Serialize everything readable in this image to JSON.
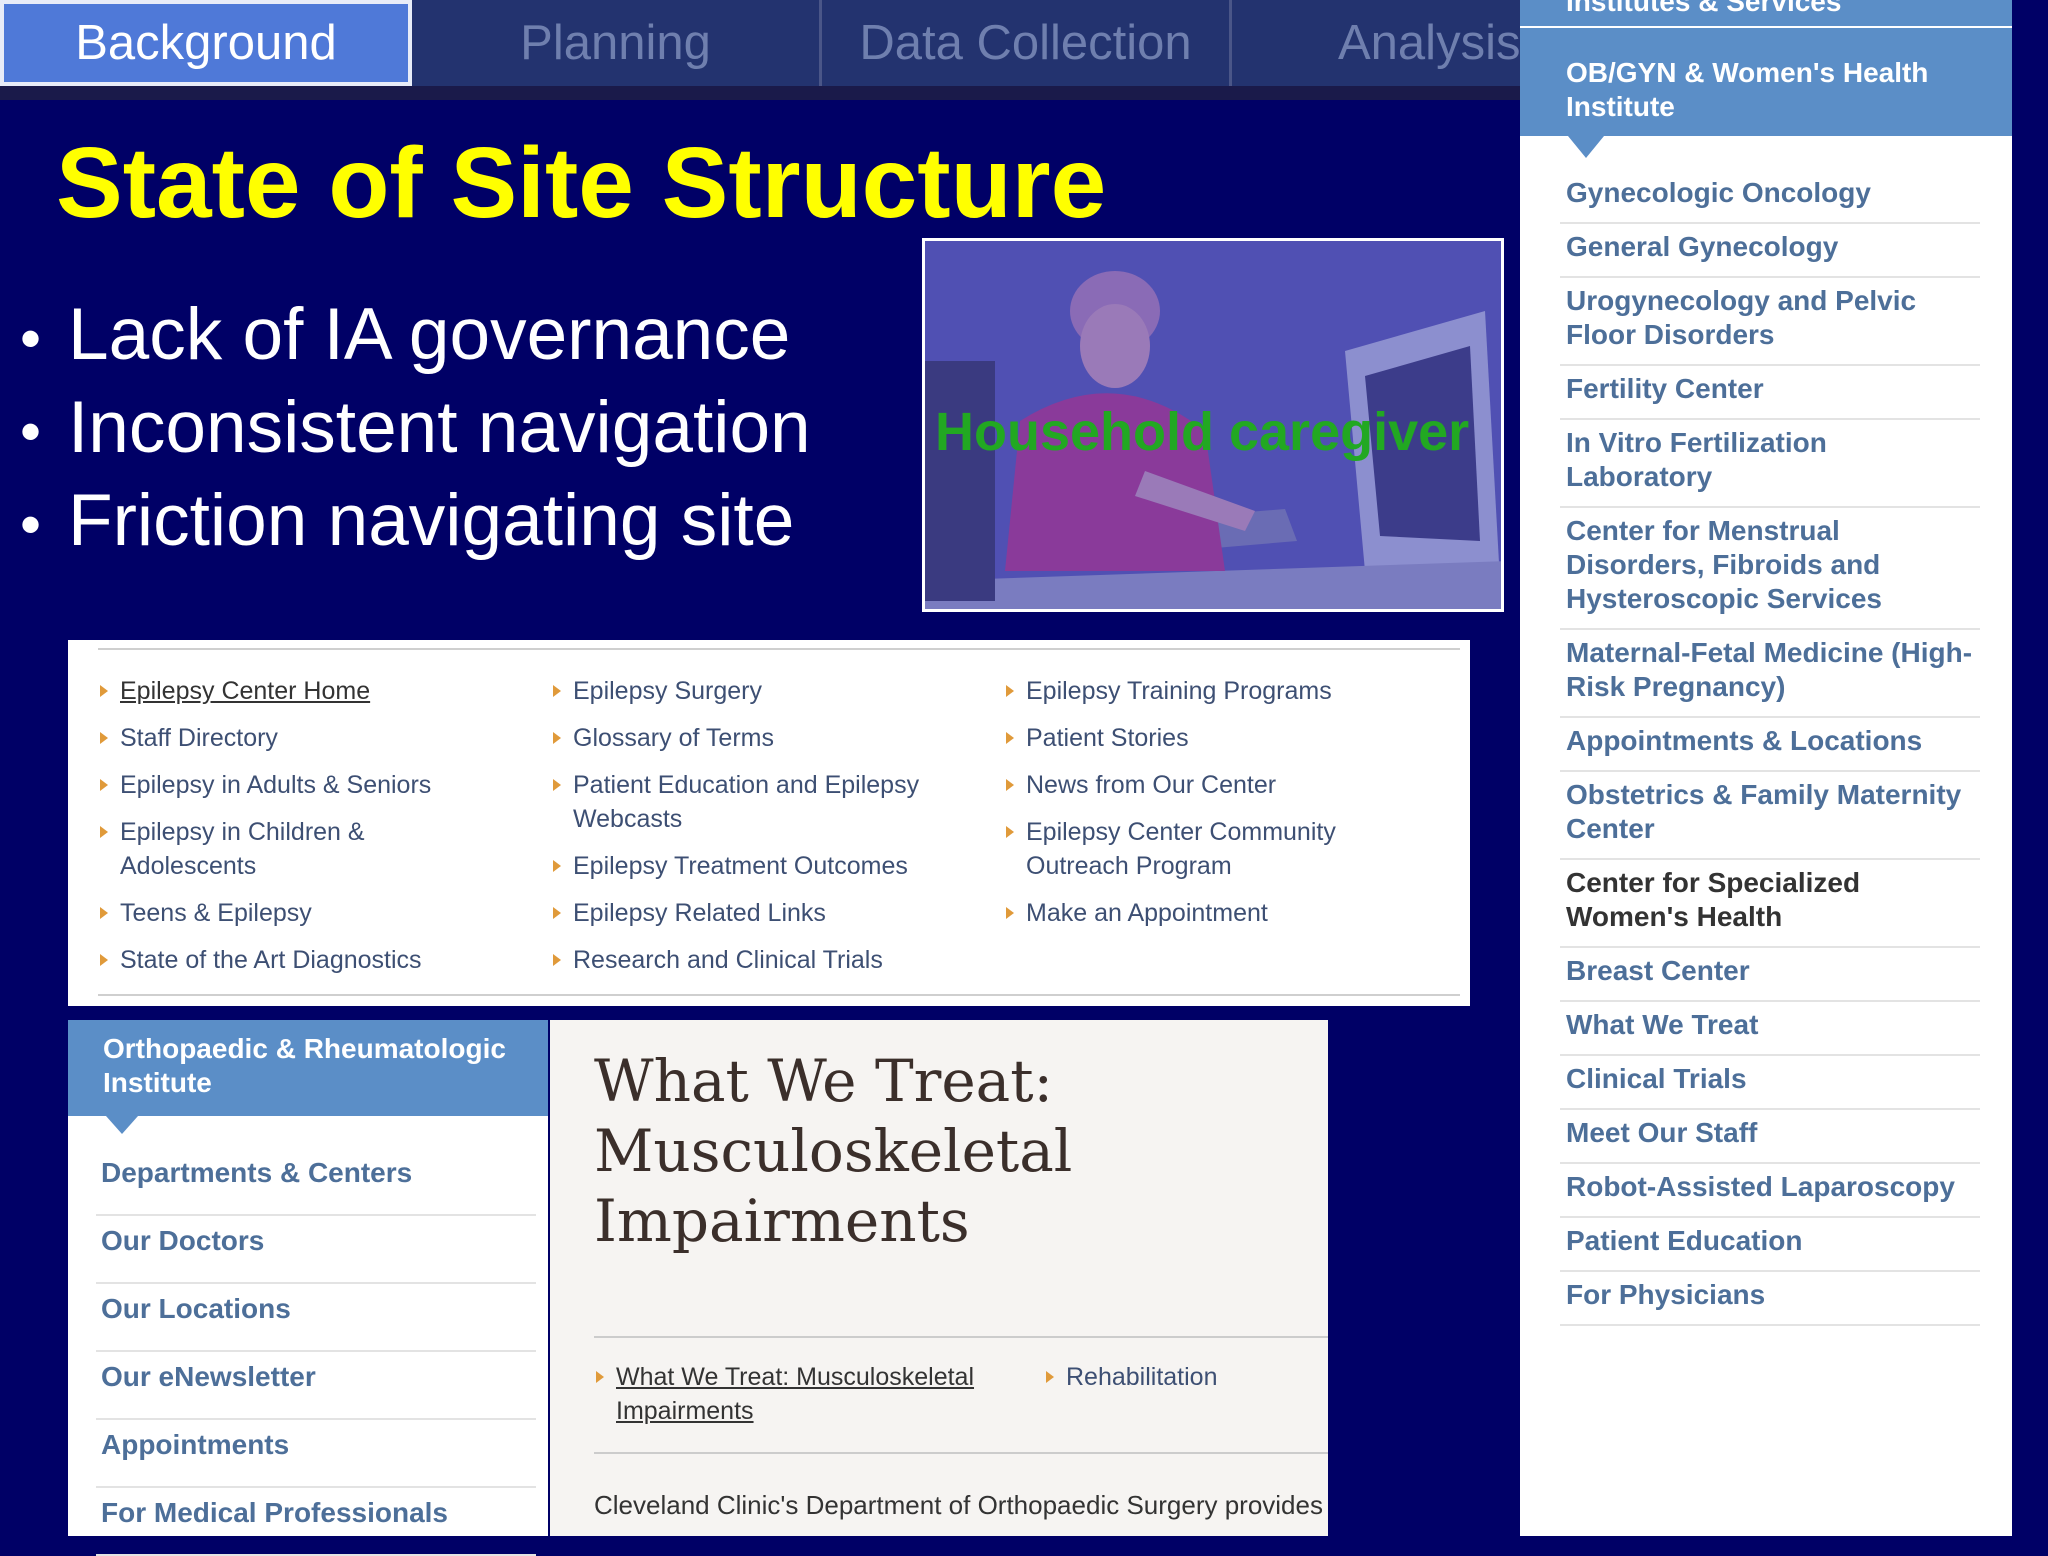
{
  "tabs": [
    {
      "label": "Background",
      "active": true
    },
    {
      "label": "Planning",
      "active": false
    },
    {
      "label": "Data Collection",
      "active": false
    },
    {
      "label": "Analysis",
      "active": false
    }
  ],
  "slide": {
    "title": "State of Site Structure",
    "bullets": [
      "Lack of IA governance",
      "Inconsistent navigation",
      "Friction navigating site"
    ],
    "photo_label": "Household caregiver"
  },
  "epilepsy_nav": {
    "col1": [
      "Epilepsy Center Home",
      "Staff Directory",
      "Epilepsy in Adults & Seniors",
      "Epilepsy in Children & Adolescents",
      "Teens & Epilepsy",
      "State of the Art Diagnostics"
    ],
    "col2": [
      "Epilepsy Surgery",
      "Glossary of Terms",
      "Patient Education and Epilepsy Webcasts",
      "Epilepsy Treatment Outcomes",
      "Epilepsy Related Links",
      "Research and Clinical Trials"
    ],
    "col3": [
      "Epilepsy Training Programs",
      "Patient Stories",
      "News from Our Center",
      "Epilepsy Center Community Outreach Program",
      "Make an Appointment"
    ]
  },
  "ortho": {
    "header": "Orthopaedic & Rheumatologic Institute",
    "items": [
      "Departments & Centers",
      "Our Doctors",
      "Our Locations",
      "Our eNewsletter",
      "Appointments",
      "For Medical Professionals"
    ],
    "page_title": "What We Treat: Musculoskeletal Impairments",
    "link_current": "What We Treat: Musculoskeletal Impairments",
    "link_other": "Rehabilitation",
    "body_text": "Cleveland Clinic's Department of Orthopaedic Surgery provides"
  },
  "obgyn": {
    "top_partial": "Institutes & Services",
    "header": "OB/GYN & Women's Health Institute",
    "items": [
      "Gynecologic Oncology",
      "General Gynecology",
      "Urogynecology and Pelvic Floor Disorders",
      "Fertility Center",
      "In Vitro Fertilization Laboratory",
      "Center for Menstrual Disorders, Fibroids and Hysteroscopic Services",
      "Maternal-Fetal Medicine (High-Risk Pregnancy)",
      "Appointments & Locations",
      "Obstetrics & Family Maternity Center",
      "Center for Specialized Women's Health",
      "Breast Center",
      "What We Treat",
      "Clinical Trials",
      "Meet Our Staff",
      "Robot-Assisted Laparoscopy",
      "Patient Education",
      "For Physicians"
    ],
    "dark_item_index": 9
  }
}
